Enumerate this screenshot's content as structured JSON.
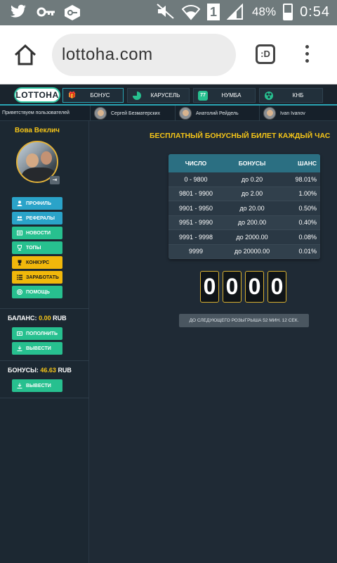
{
  "status_bar": {
    "battery": "48%",
    "time": "0:54",
    "notification_icons": [
      "twitter-icon",
      "key-icon",
      "vpn-icon"
    ],
    "system_icons": [
      "mute-icon",
      "wifi-icon",
      "sim-icon",
      "signal-icon",
      "battery-icon"
    ],
    "sim_label": "1"
  },
  "browser": {
    "url": "lottoha.com",
    "tabs_label": ":D"
  },
  "site_nav": {
    "logo": "LOTTOHA",
    "tabs": [
      {
        "label": "БОНУС",
        "icon": "gift-icon",
        "active": true
      },
      {
        "label": "КАРУСЕЛЬ",
        "icon": "pie-icon",
        "active": false
      },
      {
        "label": "НУМБА",
        "icon": "numba-icon",
        "active": false
      },
      {
        "label": "КНБ",
        "icon": "rps-icon",
        "active": false
      }
    ],
    "numba_icon_text": "77"
  },
  "welcome": {
    "text": "Приветствуем пользователей",
    "users": [
      "Сергей Безматерских",
      "Анатолий Рейдель",
      "Ivan Ivanov"
    ]
  },
  "sidebar": {
    "username": "Вова Веклич",
    "menu": [
      {
        "label": "ПРОФИЛЬ",
        "icon": "user-icon"
      },
      {
        "label": "РЕФЕРАЛЫ",
        "icon": "users-icon"
      },
      {
        "label": "НОВОСТИ",
        "icon": "news-icon"
      },
      {
        "label": "ТОПЫ",
        "icon": "cup-icon"
      },
      {
        "label": "КОНКУРС",
        "icon": "trophy-icon"
      },
      {
        "label": "ЗАРАБОТАТЬ",
        "icon": "list-icon"
      },
      {
        "label": "ПОМОЩЬ",
        "icon": "help-icon"
      }
    ],
    "balance_label": "БАЛАНС:",
    "balance_value": "0.00",
    "balance_currency": "RUB",
    "deposit_label": "ПОПОЛНИТЬ",
    "withdraw_label": "ВЫВЕСТИ",
    "bonus_label": "БОНУСЫ:",
    "bonus_value": "46.63",
    "bonus_currency": "RUB",
    "bonus_withdraw_label": "ВЫВЕСТИ"
  },
  "main": {
    "title": "БЕСПЛАТНЫЙ БОНУСНЫЙ БИЛЕТ КАЖДЫЙ ЧАС",
    "table": {
      "headers": [
        "ЧИСЛО",
        "БОНУСЫ",
        "ШАНС"
      ],
      "rows": [
        [
          "0 - 9800",
          "до 0.20",
          "98.01%"
        ],
        [
          "9801 - 9900",
          "до 2.00",
          "1.00%"
        ],
        [
          "9901 - 9950",
          "до 20.00",
          "0.50%"
        ],
        [
          "9951 - 9990",
          "до 200.00",
          "0.40%"
        ],
        [
          "9991 - 9998",
          "до 2000.00",
          "0.08%"
        ],
        [
          "9999",
          "до 20000.00",
          "0.01%"
        ]
      ]
    },
    "digits": [
      "0",
      "0",
      "0",
      "0"
    ],
    "next_draw_text": "ДО СЛЕДУЮЩЕГО РОЗЫГРЫША 52 МИН. 12 СЕК."
  },
  "colors": {
    "accent_teal": "#2aa4b4",
    "gold": "#f5c518",
    "btn_blue": "#2aa3c9",
    "btn_green": "#27c08f",
    "btn_yellow": "#f1b80b"
  }
}
